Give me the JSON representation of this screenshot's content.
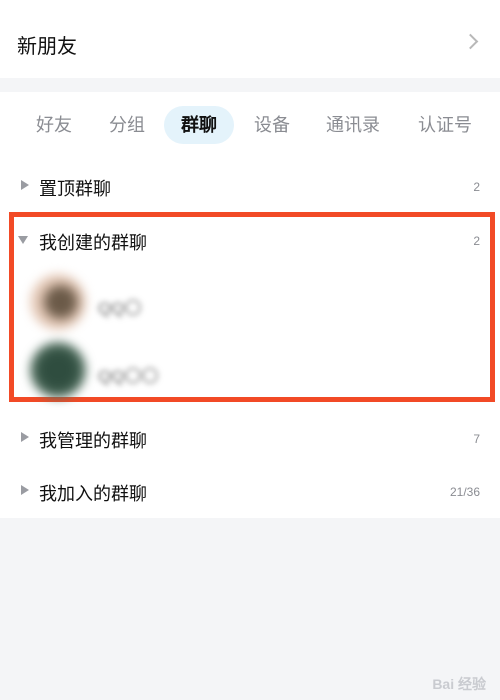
{
  "new_friends": {
    "label": "新朋友"
  },
  "tabs": [
    {
      "label": "好友",
      "active": false
    },
    {
      "label": "分组",
      "active": false
    },
    {
      "label": "群聊",
      "active": true
    },
    {
      "label": "设备",
      "active": false
    },
    {
      "label": "通讯录",
      "active": false
    },
    {
      "label": "认证号",
      "active": false
    }
  ],
  "groups": [
    {
      "label": "置顶群聊",
      "count": "2",
      "expanded": false
    },
    {
      "label": "我创建的群聊",
      "count": "2",
      "expanded": true,
      "members": [
        {
          "name": "QQ〇",
          "avatar_color": "#c9a98e"
        },
        {
          "name": "QQ〇〇",
          "avatar_color": "#4e6b5c"
        }
      ]
    },
    {
      "label": "我管理的群聊",
      "count": "7",
      "expanded": false
    },
    {
      "label": "我加入的群聊",
      "count": "21/36",
      "expanded": false
    }
  ],
  "watermark": "Bai 经验",
  "colors": {
    "highlight": "#f24a26",
    "active_tab_bg": "#e4f3fb"
  }
}
